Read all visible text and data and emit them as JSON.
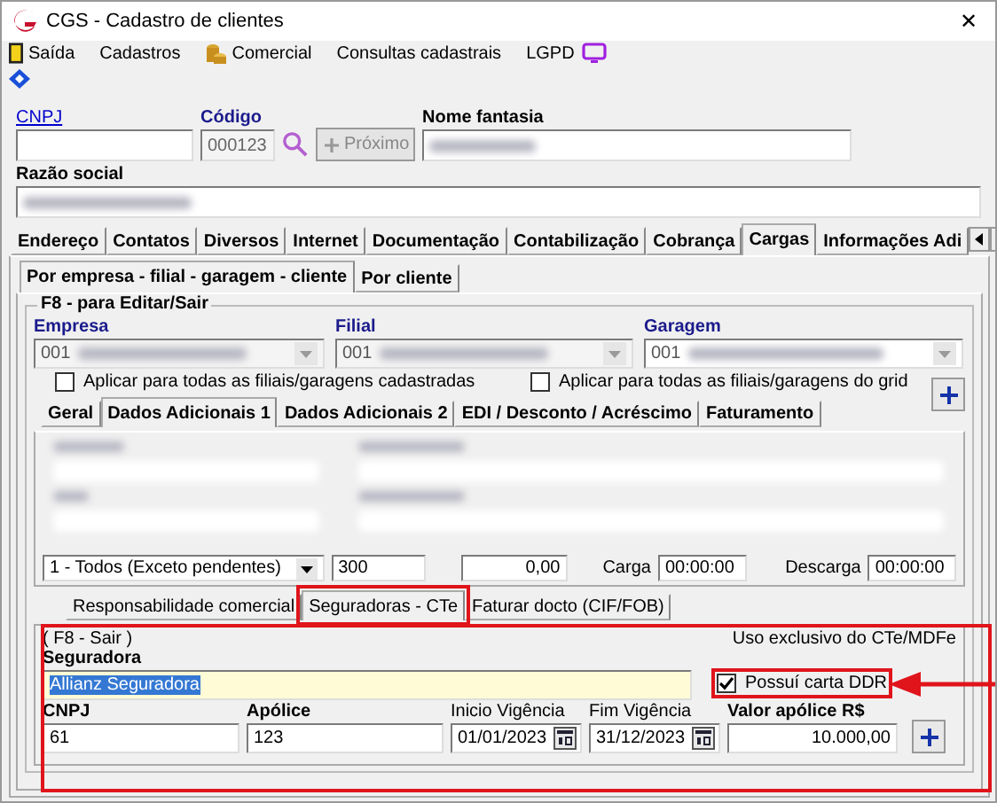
{
  "window": {
    "title": "CGS - Cadastro de clientes",
    "close": "✕"
  },
  "menu": [
    {
      "label": "Saída"
    },
    {
      "label": "Cadastros"
    },
    {
      "label": "Comercial"
    },
    {
      "label": "Consultas cadastrais"
    },
    {
      "label": "LGPD"
    }
  ],
  "header": {
    "cnpj": {
      "label": "CNPJ",
      "kind": "link"
    },
    "codigo": {
      "label": "Código",
      "kind": "blue",
      "value": "000123",
      "disabled": true
    },
    "next_button": {
      "label": "Próximo",
      "disabled": true
    },
    "nome_fantasia": {
      "label": "Nome fantasia",
      "kind": "bold"
    },
    "razao_social": {
      "label": "Razão social",
      "kind": "bold"
    }
  },
  "main_tabs": [
    {
      "label": "Endereço",
      "selected": false
    },
    {
      "label": "Contatos",
      "selected": false
    },
    {
      "label": "Diversos",
      "selected": false
    },
    {
      "label": "Internet",
      "selected": false
    },
    {
      "label": "Documentação",
      "selected": false
    },
    {
      "label": "Contabilização",
      "selected": false
    },
    {
      "label": "Cobrança",
      "selected": false
    },
    {
      "label": "Cargas",
      "selected": true
    },
    {
      "label": "Informações Adi",
      "selected": false
    }
  ],
  "sub_tabs": [
    {
      "label": "Por empresa - filial - garagem - cliente",
      "selected": true
    },
    {
      "label": "Por cliente",
      "selected": false
    }
  ],
  "group": {
    "title": "F8 - para Editar/Sair",
    "selectors": [
      {
        "label": "Empresa",
        "value": "001"
      },
      {
        "label": "Filial",
        "value": "001"
      },
      {
        "label": "Garagem",
        "value": "001"
      }
    ],
    "checkboxes": [
      {
        "label": "Aplicar para todas as filiais/garagens cadastradas",
        "checked": false
      },
      {
        "label": "Aplicar para todas as filiais/garagens do grid",
        "checked": false
      }
    ]
  },
  "inner_tabs": [
    {
      "label": "Geral",
      "selected": false
    },
    {
      "label": "Dados Adicionais 1",
      "selected": true
    },
    {
      "label": "Dados Adicionais 2",
      "selected": false
    },
    {
      "label": "EDI / Desconto / Acréscimo",
      "selected": false
    },
    {
      "label": "Faturamento",
      "selected": false
    }
  ],
  "details_row": {
    "combo": "1 - Todos (Exceto pendentes)",
    "field_1": "300",
    "field_2": "0,00",
    "carga_label": "Carga",
    "carga": "00:00:00",
    "descarga_label": "Descarga",
    "descarga": "00:00:00"
  },
  "bottom_tabs": [
    {
      "label": "Responsabilidade comercial",
      "selected": false,
      "highlighted": false
    },
    {
      "label": "Seguradoras - CTe",
      "selected": true,
      "highlighted": true
    },
    {
      "label": "Faturar docto (CIF/FOB)",
      "selected": false,
      "highlighted": false
    }
  ],
  "insurer_panel": {
    "hint": "( F8 - Sair )",
    "note": "Uso exclusivo do CTe/MDFe",
    "seguradora": {
      "label": "Seguradora",
      "kind": "bold",
      "value": "Allianz Seguradora",
      "selected": true
    },
    "ddr": {
      "label": "Possuí carta DDR",
      "checked": true,
      "highlighted": true
    },
    "fields": [
      {
        "label": "CNPJ",
        "kind": "text",
        "value": "61"
      },
      {
        "label": "Apólice",
        "kind": "text",
        "value": "123"
      },
      {
        "label": "Inicio Vigência",
        "kind": "date",
        "value": "01/01/2023"
      },
      {
        "label": "Fim Vigência",
        "kind": "date",
        "value": "31/12/2023"
      },
      {
        "label": "Valor apólice R$",
        "kind": "amount",
        "value": "10.000,00"
      }
    ]
  }
}
